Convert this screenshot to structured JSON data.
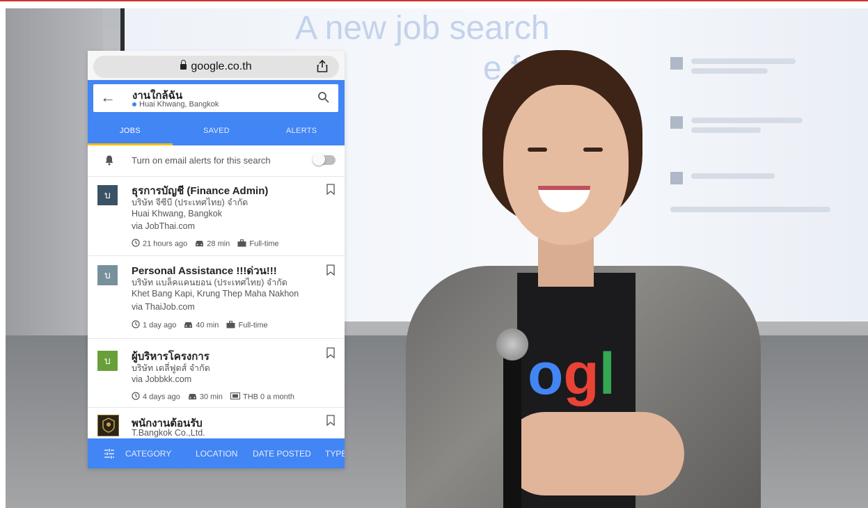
{
  "background": {
    "screen_headline_line1": "A new job search",
    "screen_headline_line2": "e for",
    "shirt_logo": "ogl"
  },
  "browser": {
    "url": "google.co.th"
  },
  "search": {
    "query": "งานใกล้ฉัน",
    "location": "Huai Khwang, Bangkok"
  },
  "tabs": [
    {
      "label": "JOBS"
    },
    {
      "label": "SAVED"
    },
    {
      "label": "ALERTS"
    }
  ],
  "alert_row": {
    "text": "Turn on email alerts for this search"
  },
  "jobs": [
    {
      "logo_letter": "บ",
      "logo_color": "#3a5264",
      "title": "ธุรการบัญชี (Finance Admin)",
      "company": "บริษัท จีซีบี (ประเทศไทย) จำกัด",
      "location": "Huai Khwang, Bangkok",
      "via": "via JobThai.com",
      "posted": "21 hours ago",
      "commute": "28 min",
      "type": "Full-time"
    },
    {
      "logo_letter": "บ",
      "logo_color": "#78909c",
      "title": "Personal Assistance !!!ด่วน!!!",
      "company": "บริษัท แบล็คแคนยอน (ประเทศไทย) จำกัด",
      "location": "Khet Bang Kapi, Krung Thep Maha Nakhon",
      "via": "via ThaiJob.com",
      "posted": "1 day ago",
      "commute": "40 min",
      "type": "Full-time"
    },
    {
      "logo_letter": "บ",
      "logo_color": "#689f38",
      "title": "ผู้บริหารโครงการ",
      "company": "บริษัท เดลี่ฟูดส์ จำกัด",
      "via": "via Jobbkk.com",
      "posted": "4 days ago",
      "commute": "30 min",
      "salary": "THB 0 a month"
    },
    {
      "title": "พนักงานต้อนรับ",
      "company": "T.Bangkok Co.,Ltd."
    }
  ],
  "filters": [
    {
      "label": "CATEGORY"
    },
    {
      "label": "LOCATION"
    },
    {
      "label": "DATE POSTED"
    },
    {
      "label": "TYPE"
    }
  ],
  "colors": {
    "google_blue": "#4285f4",
    "tab_indicator": "#fbbc05"
  }
}
